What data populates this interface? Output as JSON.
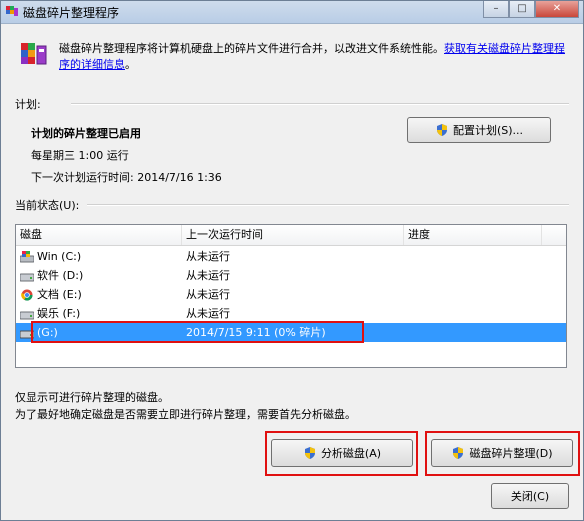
{
  "window": {
    "title": "磁盘碎片整理程序",
    "controls": {
      "minimize": "–",
      "maximize": "□",
      "close": "✕"
    }
  },
  "header": {
    "text": "磁盘碎片整理程序将计算机硬盘上的碎片文件进行合并，以改进文件系统性能。",
    "link": "获取有关磁盘碎片整理程序的详细信息",
    "link_end": "。"
  },
  "schedule": {
    "label": "计划:",
    "status": "计划的碎片整理已启用",
    "frequency": "每星期三  1:00 运行",
    "next_run": "下一次计划运行时间: 2014/7/16 1:36",
    "configure_button": "配置计划(S)..."
  },
  "current_status": {
    "label": "当前状态(U):",
    "columns": [
      "磁盘",
      "上一次运行时间",
      "进度"
    ],
    "rows": [
      {
        "disk": "Win (C:)",
        "last_run": "从未运行",
        "icon": "windows-drive-icon",
        "selected": false
      },
      {
        "disk": "软件 (D:)",
        "last_run": "从未运行",
        "icon": "drive-icon",
        "selected": false
      },
      {
        "disk": "文档 (E:)",
        "last_run": "从未运行",
        "icon": "chrome-drive-icon",
        "selected": false
      },
      {
        "disk": "娱乐 (F:)",
        "last_run": "从未运行",
        "icon": "drive-icon",
        "selected": false
      },
      {
        "disk": "(G:)",
        "last_run": "2014/7/15 9:11 (0% 碎片)",
        "icon": "drive-icon",
        "selected": true
      }
    ]
  },
  "info": {
    "line1": "仅显示可进行碎片整理的磁盘。",
    "line2": "为了最好地确定磁盘是否需要立即进行碎片整理，需要首先分析磁盘。"
  },
  "buttons": {
    "analyze": "分析磁盘(A)",
    "defrag": "磁盘碎片整理(D)",
    "close": "关闭(C)"
  },
  "colors": {
    "selection": "#3399ff",
    "highlight_box": "#e01010",
    "link": "#0000ee"
  }
}
